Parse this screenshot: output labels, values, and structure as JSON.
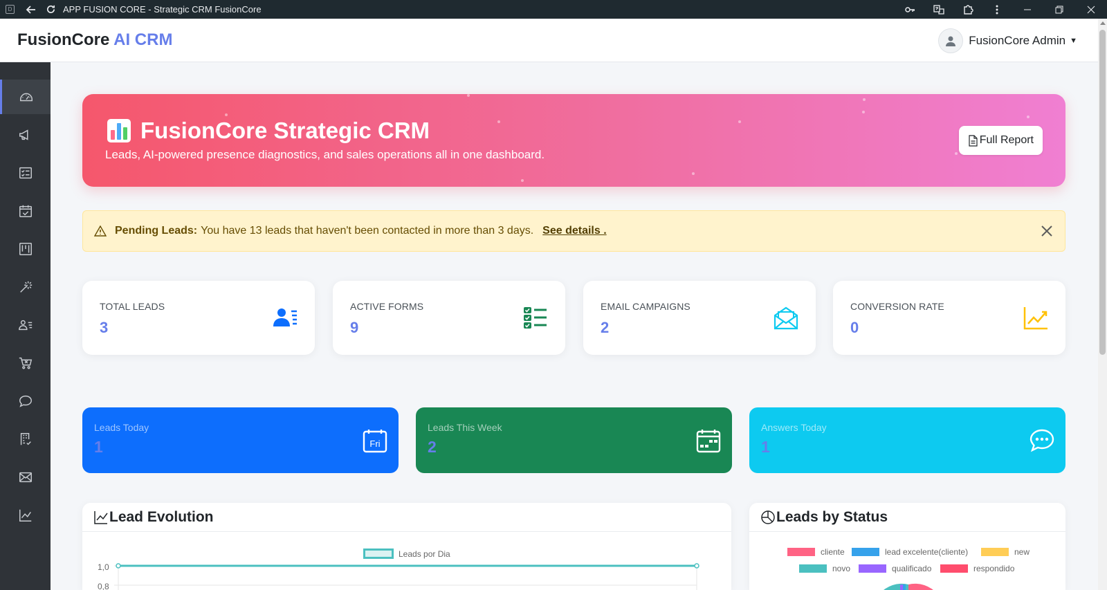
{
  "browser": {
    "app_icon": "D",
    "title": "APP FUSION CORE - Strategic CRM FusionCore"
  },
  "brand": {
    "name": "FusionCore",
    "accent": "AI CRM"
  },
  "user": {
    "name": "FusionCore Admin"
  },
  "sidebar": {
    "items": [
      {
        "icon": "dashboard-icon",
        "active": true
      },
      {
        "icon": "megaphone-icon"
      },
      {
        "icon": "form-list-icon"
      },
      {
        "icon": "calendar-check-icon"
      },
      {
        "icon": "kanban-icon"
      },
      {
        "icon": "magic-wand-icon"
      },
      {
        "icon": "user-list-icon"
      },
      {
        "icon": "cart-icon"
      },
      {
        "icon": "chat-icon"
      },
      {
        "icon": "building-check-icon"
      },
      {
        "icon": "envelope-icon"
      },
      {
        "icon": "line-chart-icon"
      }
    ]
  },
  "hero": {
    "title": "FusionCore Strategic CRM",
    "subtitle": "Leads, AI-powered presence diagnostics, and sales operations all in one dashboard.",
    "button": "Full Report"
  },
  "alert": {
    "bold": "Pending Leads:",
    "text": "You have 13 leads that haven't been contacted in more than 3 days.",
    "link": "See details ."
  },
  "stats": [
    {
      "label": "TOTAL LEADS",
      "value": "3",
      "icon": "user-list-icon",
      "color": "#0d6efd"
    },
    {
      "label": "ACTIVE FORMS",
      "value": "9",
      "icon": "checklist-icon",
      "color": "#198754"
    },
    {
      "label": "EMAIL CAMPAIGNS",
      "value": "2",
      "icon": "envelope-open-icon",
      "color": "#0dcaf0"
    },
    {
      "label": "CONVERSION RATE",
      "value": "0",
      "icon": "graph-up-icon",
      "color": "#ffc107"
    }
  ],
  "colored_cards": [
    {
      "label": "Leads Today",
      "value": "1",
      "icon": "calendar-day-icon",
      "icon_text": "Fri",
      "bg": "#0d6efd"
    },
    {
      "label": "Leads This Week",
      "value": "2",
      "icon": "calendar-week-icon",
      "bg": "#198754"
    },
    {
      "label": "Answers Today",
      "value": "1",
      "icon": "chat-dots-icon",
      "bg": "#0dcaf0"
    }
  ],
  "lead_evolution": {
    "title": "Lead Evolution",
    "chart_data": {
      "type": "line",
      "series": [
        {
          "name": "Leads por Dia",
          "values": [
            1.0,
            1.0
          ]
        }
      ],
      "yticks": [
        "1,0",
        "0,8"
      ],
      "color": "#4bc0c0"
    }
  },
  "leads_by_status": {
    "title": "Leads by Status",
    "chart_data": {
      "type": "pie",
      "legend": [
        {
          "label": "cliente",
          "color": "#ff6384"
        },
        {
          "label": "lead excelente(cliente)",
          "color": "#36a2eb"
        },
        {
          "label": "new",
          "color": "#ffcd56"
        },
        {
          "label": "novo",
          "color": "#4bc0c0"
        },
        {
          "label": "qualificado",
          "color": "#9966ff"
        },
        {
          "label": "respondido",
          "color": "#ff4d6d"
        }
      ]
    }
  }
}
